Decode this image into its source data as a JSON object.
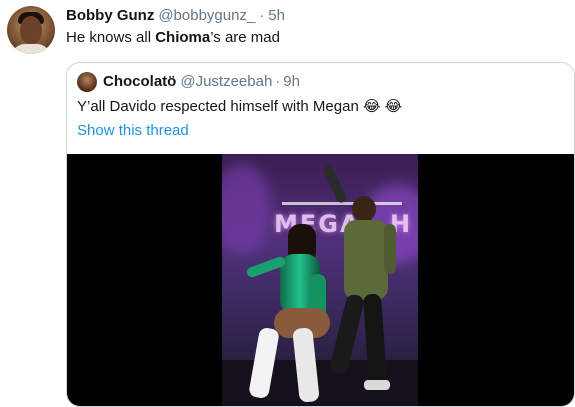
{
  "tweet": {
    "author_name": "Bobby Gunz",
    "author_handle": "@bobbygunz_",
    "separator": "·",
    "timestamp": "5h",
    "text_before": "He knows all ",
    "text_bold": "Chioma",
    "text_after": "’s are mad"
  },
  "quoted_tweet": {
    "author_name": "Chocolatö",
    "author_handle": "@Justzeebah",
    "separator": "·",
    "timestamp": "9h",
    "text": "Y’all Davido respected himself with Megan 😂 😂",
    "thread_link": "Show this thread"
  },
  "media": {
    "stage_sign": "MEGA",
    "stage_sign_end": "H"
  },
  "colors": {
    "link": "#1b95e0",
    "secondary_text": "#657786",
    "border": "#ccd6dd"
  }
}
